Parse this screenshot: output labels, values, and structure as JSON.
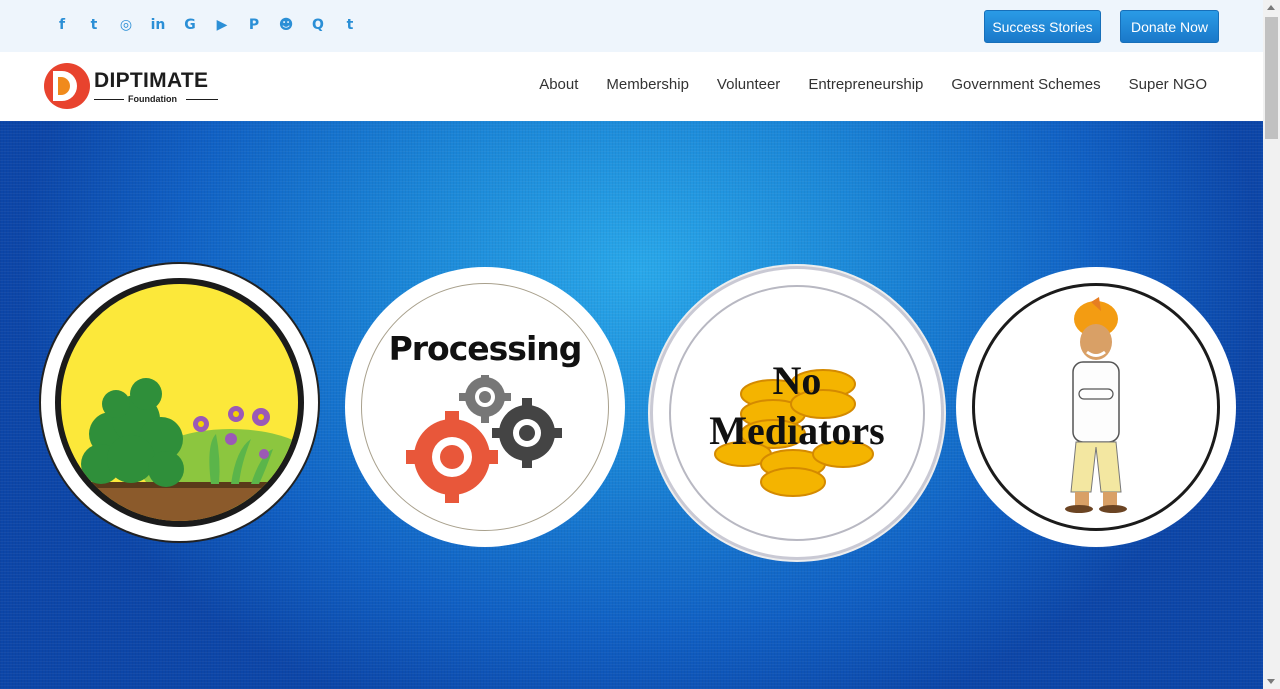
{
  "social": [
    {
      "icon": "facebook-icon",
      "glyph": "f"
    },
    {
      "icon": "twitter-icon",
      "glyph": "t"
    },
    {
      "icon": "instagram-icon",
      "glyph": "◎"
    },
    {
      "icon": "linkedin-icon",
      "glyph": "in"
    },
    {
      "icon": "google-icon",
      "glyph": "G"
    },
    {
      "icon": "youtube-icon",
      "glyph": "▶"
    },
    {
      "icon": "pinterest-icon",
      "glyph": "P"
    },
    {
      "icon": "reddit-icon",
      "glyph": "☻"
    },
    {
      "icon": "quora-icon",
      "glyph": "Q"
    },
    {
      "icon": "tumblr-icon",
      "glyph": "t"
    }
  ],
  "buttons": {
    "success_stories": "Success Stories",
    "donate_now": "Donate Now"
  },
  "logo": {
    "name": "DIPTIMATE",
    "sub": "Foundation"
  },
  "nav": [
    "About",
    "Membership",
    "Volunteer",
    "Entrepreneurship",
    "Government Schemes",
    "Super NGO"
  ],
  "hero": {
    "processing_label": "Processing",
    "no_label": "No",
    "mediators_label": "Mediators"
  },
  "colors": {
    "accent": "#1a78c9",
    "social_icon": "#2b8fd6",
    "logo_red": "#e8432e",
    "logo_orange": "#f08a1c"
  }
}
